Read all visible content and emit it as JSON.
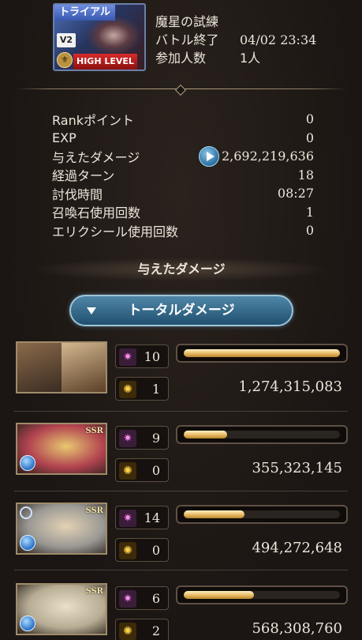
{
  "quest": {
    "trial_label": "トライアル",
    "version_label": "V2",
    "level_label": "HIGH LEVEL",
    "name": "魔星の試練",
    "battle_end_label": "バトル終了",
    "battle_end_value": "04/02 23:34",
    "participants_label": "参加人数",
    "participants_value": "1人"
  },
  "stats": [
    {
      "label": "Rankポイント",
      "value": "0"
    },
    {
      "label": "EXP",
      "value": "0"
    },
    {
      "label": "与えたダメージ",
      "value": "2,692,219,636"
    },
    {
      "label": "経過ターン",
      "value": "18"
    },
    {
      "label": "討伐時間",
      "value": "08:27"
    },
    {
      "label": "召喚石使用回数",
      "value": "1"
    },
    {
      "label": "エリクシール使用回数",
      "value": "0"
    }
  ],
  "section_title": "与えたダメージ",
  "damage_select_label": "トータルダメージ",
  "party": [
    {
      "skill_count": "10",
      "ougi_count": "1",
      "damage": "1,274,315,083",
      "bar_fraction": 1.0,
      "colors": [
        "#8a6a4a",
        "#d3b890"
      ]
    },
    {
      "skill_count": "9",
      "ougi_count": "0",
      "damage": "355,323,145",
      "bar_fraction": 0.28,
      "colors": [
        "#b24350",
        "#e7c870"
      ]
    },
    {
      "skill_count": "14",
      "ougi_count": "0",
      "damage": "494,272,648",
      "bar_fraction": 0.39,
      "colors": [
        "#9a9894",
        "#e3d2b4"
      ]
    },
    {
      "skill_count": "6",
      "ougi_count": "2",
      "damage": "568,308,760",
      "bar_fraction": 0.45,
      "colors": [
        "#b7ad95",
        "#e8e0c7"
      ]
    }
  ]
}
